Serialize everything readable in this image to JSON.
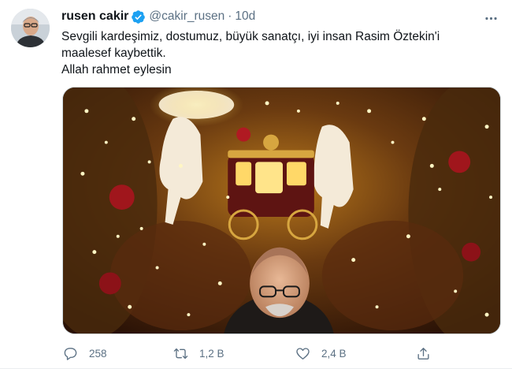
{
  "tweet": {
    "author": {
      "name": "rusen cakir",
      "handle": "@cakir_rusen",
      "verified": true
    },
    "separator": "·",
    "time": "10d",
    "text_lines": [
      "Sevgili kardeşimiz, dostumuz, büyük sanatçı, iyi insan Rasim Öztekin'i",
      "maalesef kaybettik.",
      "Allah rahmet eylesin"
    ],
    "media": {
      "kind": "photo"
    },
    "actions": {
      "replies": "258",
      "retweets": "1,2 B",
      "likes": "2,4 B"
    },
    "icons": {
      "more": "more-horizontal-icon",
      "reply": "reply-icon",
      "retweet": "retweet-icon",
      "like": "heart-icon",
      "share": "share-icon",
      "verified": "verified-badge-icon"
    },
    "colors": {
      "text": "#0f1419",
      "secondary": "#5b7083",
      "verified": "#1da1f2",
      "border": "#cfd9de"
    }
  }
}
